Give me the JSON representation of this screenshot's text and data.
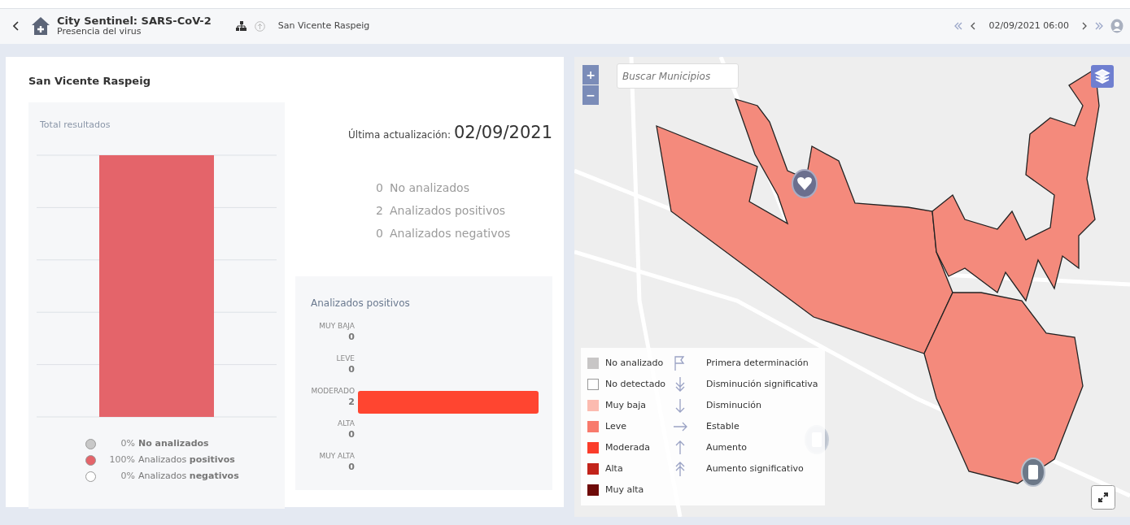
{
  "header": {
    "title": "City Sentinel: SARS-CoV-2",
    "subtitle": "Presencia del virus",
    "breadcrumb": "San Vicente Raspeig",
    "date": "02/09/2021 06:00"
  },
  "panel": {
    "title": "San Vicente Raspeig",
    "total": {
      "title": "Total resultados"
    },
    "legend": [
      {
        "percent": "0%",
        "label": "**No analizados**",
        "color": "#c8c8c8"
      },
      {
        "percent": "100%",
        "label": "Analizados **positivos**",
        "color": "#e4646a"
      },
      {
        "percent": "0%",
        "label": "Analizados **negativos**",
        "color": "#ffffff"
      }
    ],
    "update": {
      "label": "Última actualización:",
      "date": "02/09/2021"
    },
    "counts": [
      {
        "value": "0",
        "label": "No analizados"
      },
      {
        "value": "2",
        "label": "Analizados positivos"
      },
      {
        "value": "0",
        "label": "Analizados negativos"
      }
    ],
    "positives": {
      "title": "Analizados positivos",
      "chart_data": {
        "type": "bar",
        "orientation": "horizontal",
        "categories": [
          "MUY BAJA",
          "LEVE",
          "MODERADO",
          "ALTA",
          "MUY ALTA"
        ],
        "values": [
          0,
          0,
          2,
          0,
          0
        ],
        "data_labels": true
      }
    }
  },
  "map": {
    "search": {
      "placeholder": "Buscar Municipios"
    },
    "zoom": [
      "+",
      "−"
    ],
    "levels": [
      {
        "label": "No analizado",
        "color": "#c8c6c6"
      },
      {
        "label": "No detectado",
        "color": "#ffffff"
      },
      {
        "label": "Muy baja",
        "color": "#fcbbb0"
      },
      {
        "label": "Leve",
        "color": "#f87a6c"
      },
      {
        "label": "Moderada",
        "color": "#fb3c2a"
      },
      {
        "label": "Alta",
        "color": "#c2231a"
      },
      {
        "label": "Muy alta",
        "color": "#6e0a08"
      }
    ],
    "trends": [
      {
        "label": "Primera determinación",
        "kind": "flag"
      },
      {
        "label": "Disminución significativa",
        "kind": "double-down"
      },
      {
        "label": "Disminución",
        "kind": "down"
      },
      {
        "label": "Estable",
        "kind": "right"
      },
      {
        "label": "Aumento",
        "kind": "up"
      },
      {
        "label": "Aumento significativo",
        "kind": "double-up"
      }
    ]
  }
}
